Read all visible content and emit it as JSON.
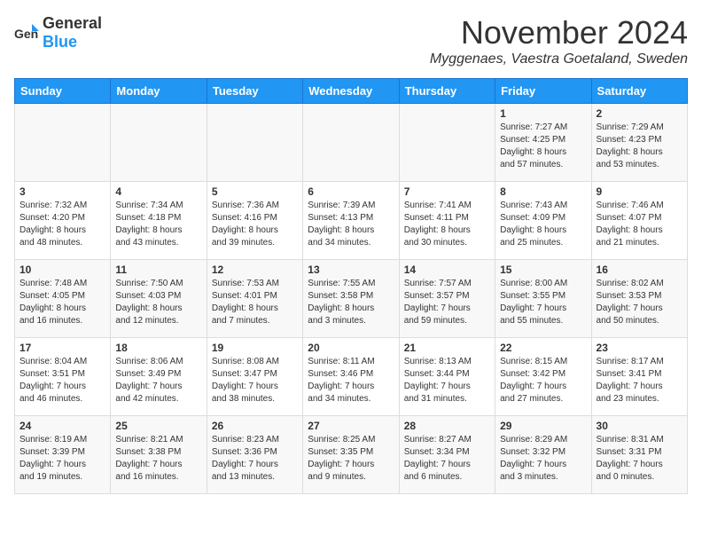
{
  "logo": {
    "general": "General",
    "blue": "Blue"
  },
  "header": {
    "month": "November 2024",
    "location": "Myggenaes, Vaestra Goetaland, Sweden"
  },
  "weekdays": [
    "Sunday",
    "Monday",
    "Tuesday",
    "Wednesday",
    "Thursday",
    "Friday",
    "Saturday"
  ],
  "weeks": [
    [
      {
        "day": "",
        "info": ""
      },
      {
        "day": "",
        "info": ""
      },
      {
        "day": "",
        "info": ""
      },
      {
        "day": "",
        "info": ""
      },
      {
        "day": "",
        "info": ""
      },
      {
        "day": "1",
        "info": "Sunrise: 7:27 AM\nSunset: 4:25 PM\nDaylight: 8 hours\nand 57 minutes."
      },
      {
        "day": "2",
        "info": "Sunrise: 7:29 AM\nSunset: 4:23 PM\nDaylight: 8 hours\nand 53 minutes."
      }
    ],
    [
      {
        "day": "3",
        "info": "Sunrise: 7:32 AM\nSunset: 4:20 PM\nDaylight: 8 hours\nand 48 minutes."
      },
      {
        "day": "4",
        "info": "Sunrise: 7:34 AM\nSunset: 4:18 PM\nDaylight: 8 hours\nand 43 minutes."
      },
      {
        "day": "5",
        "info": "Sunrise: 7:36 AM\nSunset: 4:16 PM\nDaylight: 8 hours\nand 39 minutes."
      },
      {
        "day": "6",
        "info": "Sunrise: 7:39 AM\nSunset: 4:13 PM\nDaylight: 8 hours\nand 34 minutes."
      },
      {
        "day": "7",
        "info": "Sunrise: 7:41 AM\nSunset: 4:11 PM\nDaylight: 8 hours\nand 30 minutes."
      },
      {
        "day": "8",
        "info": "Sunrise: 7:43 AM\nSunset: 4:09 PM\nDaylight: 8 hours\nand 25 minutes."
      },
      {
        "day": "9",
        "info": "Sunrise: 7:46 AM\nSunset: 4:07 PM\nDaylight: 8 hours\nand 21 minutes."
      }
    ],
    [
      {
        "day": "10",
        "info": "Sunrise: 7:48 AM\nSunset: 4:05 PM\nDaylight: 8 hours\nand 16 minutes."
      },
      {
        "day": "11",
        "info": "Sunrise: 7:50 AM\nSunset: 4:03 PM\nDaylight: 8 hours\nand 12 minutes."
      },
      {
        "day": "12",
        "info": "Sunrise: 7:53 AM\nSunset: 4:01 PM\nDaylight: 8 hours\nand 7 minutes."
      },
      {
        "day": "13",
        "info": "Sunrise: 7:55 AM\nSunset: 3:58 PM\nDaylight: 8 hours\nand 3 minutes."
      },
      {
        "day": "14",
        "info": "Sunrise: 7:57 AM\nSunset: 3:57 PM\nDaylight: 7 hours\nand 59 minutes."
      },
      {
        "day": "15",
        "info": "Sunrise: 8:00 AM\nSunset: 3:55 PM\nDaylight: 7 hours\nand 55 minutes."
      },
      {
        "day": "16",
        "info": "Sunrise: 8:02 AM\nSunset: 3:53 PM\nDaylight: 7 hours\nand 50 minutes."
      }
    ],
    [
      {
        "day": "17",
        "info": "Sunrise: 8:04 AM\nSunset: 3:51 PM\nDaylight: 7 hours\nand 46 minutes."
      },
      {
        "day": "18",
        "info": "Sunrise: 8:06 AM\nSunset: 3:49 PM\nDaylight: 7 hours\nand 42 minutes."
      },
      {
        "day": "19",
        "info": "Sunrise: 8:08 AM\nSunset: 3:47 PM\nDaylight: 7 hours\nand 38 minutes."
      },
      {
        "day": "20",
        "info": "Sunrise: 8:11 AM\nSunset: 3:46 PM\nDaylight: 7 hours\nand 34 minutes."
      },
      {
        "day": "21",
        "info": "Sunrise: 8:13 AM\nSunset: 3:44 PM\nDaylight: 7 hours\nand 31 minutes."
      },
      {
        "day": "22",
        "info": "Sunrise: 8:15 AM\nSunset: 3:42 PM\nDaylight: 7 hours\nand 27 minutes."
      },
      {
        "day": "23",
        "info": "Sunrise: 8:17 AM\nSunset: 3:41 PM\nDaylight: 7 hours\nand 23 minutes."
      }
    ],
    [
      {
        "day": "24",
        "info": "Sunrise: 8:19 AM\nSunset: 3:39 PM\nDaylight: 7 hours\nand 19 minutes."
      },
      {
        "day": "25",
        "info": "Sunrise: 8:21 AM\nSunset: 3:38 PM\nDaylight: 7 hours\nand 16 minutes."
      },
      {
        "day": "26",
        "info": "Sunrise: 8:23 AM\nSunset: 3:36 PM\nDaylight: 7 hours\nand 13 minutes."
      },
      {
        "day": "27",
        "info": "Sunrise: 8:25 AM\nSunset: 3:35 PM\nDaylight: 7 hours\nand 9 minutes."
      },
      {
        "day": "28",
        "info": "Sunrise: 8:27 AM\nSunset: 3:34 PM\nDaylight: 7 hours\nand 6 minutes."
      },
      {
        "day": "29",
        "info": "Sunrise: 8:29 AM\nSunset: 3:32 PM\nDaylight: 7 hours\nand 3 minutes."
      },
      {
        "day": "30",
        "info": "Sunrise: 8:31 AM\nSunset: 3:31 PM\nDaylight: 7 hours\nand 0 minutes."
      }
    ]
  ]
}
